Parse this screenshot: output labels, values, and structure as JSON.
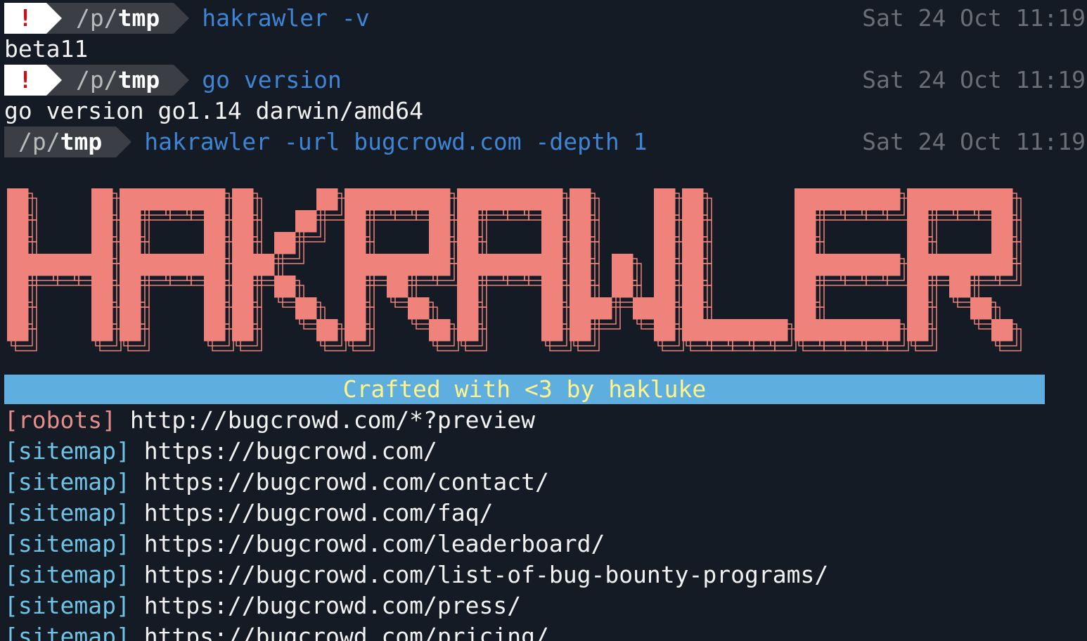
{
  "prompts": [
    {
      "error_mark": "!",
      "path_prefix": "/p/",
      "path_dir": "tmp",
      "command": "hakrawler -v",
      "time": "Sat 24 Oct 11:19"
    },
    {
      "error_mark": "!",
      "path_prefix": "/p/",
      "path_dir": "tmp",
      "command": "go version",
      "time": "Sat 24 Oct 11:19"
    },
    {
      "path_prefix": "/p/",
      "path_dir": "tmp",
      "command": "hakrawler -url bugcrowd.com -depth 1",
      "time": "Sat 24 Oct 11:19"
    }
  ],
  "outputs": {
    "version": "beta11",
    "go_version": "go version go1.14 darwin/amd64"
  },
  "banner": {
    "title": "HAKRAWLER",
    "tagline": "Crafted with <3 by hakluke",
    "colors": {
      "letters": "#ef827b",
      "tagline_bg": "#5eafdf",
      "tagline_fg": "#fff38a"
    }
  },
  "results": [
    {
      "tag": "[robots]",
      "url": "http://bugcrowd.com/*?preview"
    },
    {
      "tag": "[sitemap]",
      "url": "https://bugcrowd.com/"
    },
    {
      "tag": "[sitemap]",
      "url": "https://bugcrowd.com/contact/"
    },
    {
      "tag": "[sitemap]",
      "url": "https://bugcrowd.com/faq/"
    },
    {
      "tag": "[sitemap]",
      "url": "https://bugcrowd.com/leaderboard/"
    },
    {
      "tag": "[sitemap]",
      "url": "https://bugcrowd.com/list-of-bug-bounty-programs/"
    },
    {
      "tag": "[sitemap]",
      "url": "https://bugcrowd.com/press/"
    },
    {
      "tag": "[sitemap]",
      "url": "https://bugcrowd.com/pricing/"
    }
  ]
}
